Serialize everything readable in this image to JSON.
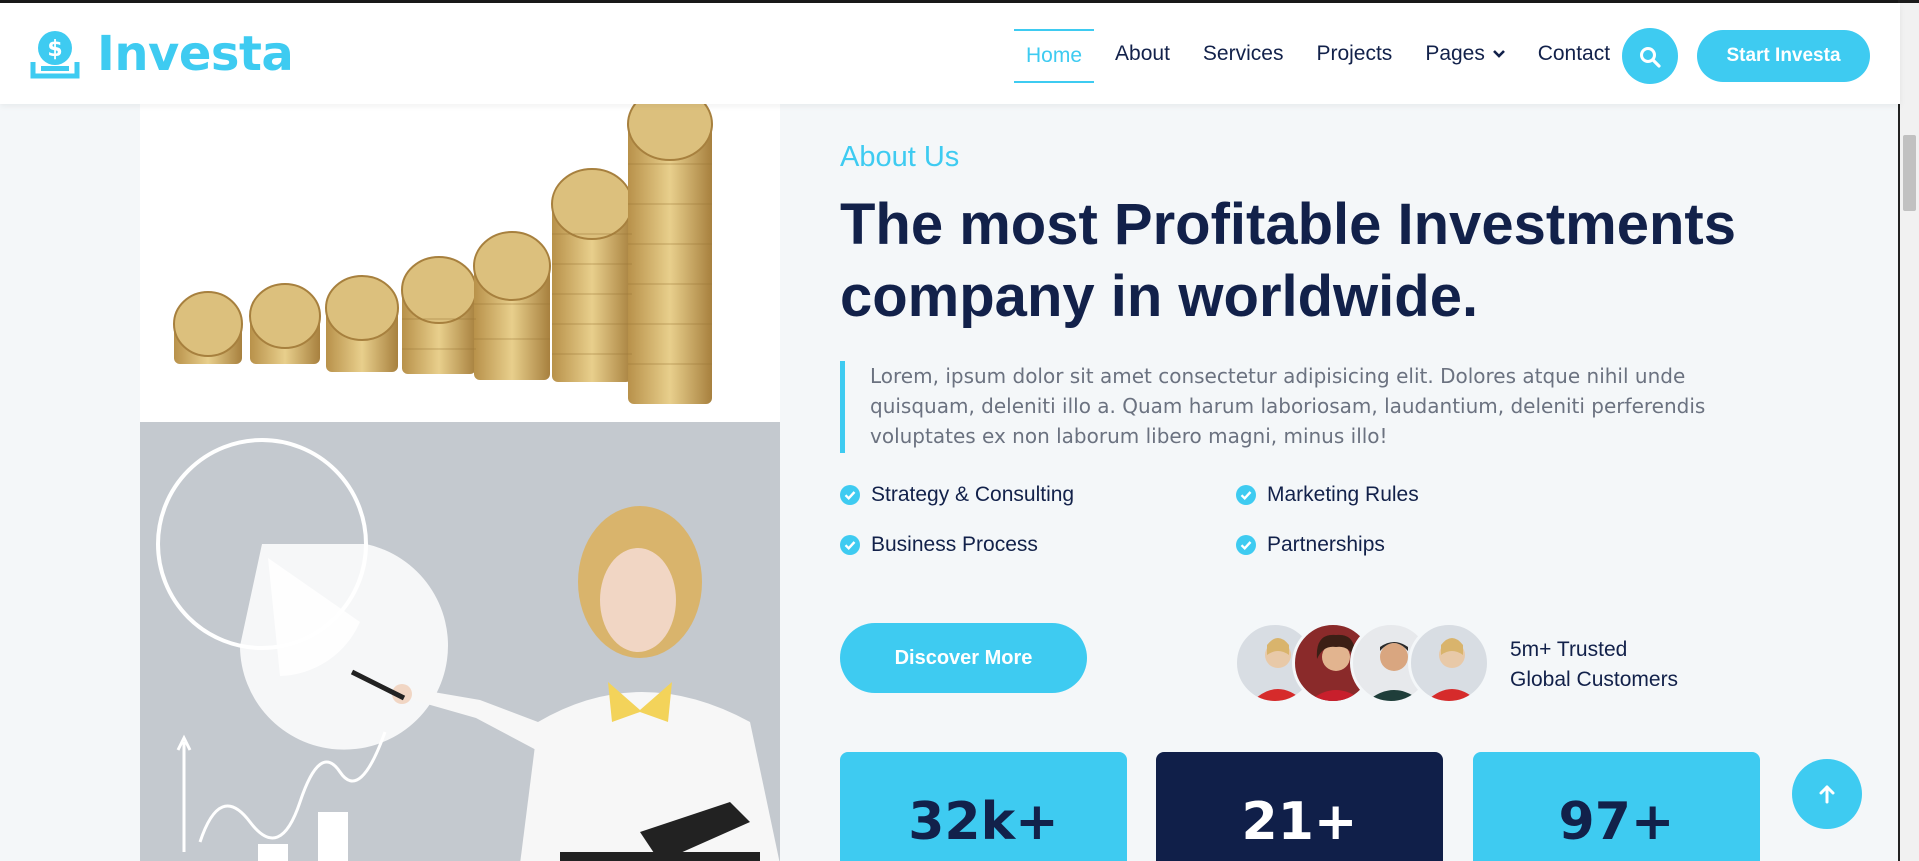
{
  "brand": {
    "name": "Investa",
    "icon": "dollar-coin-icon"
  },
  "nav": {
    "items": [
      {
        "label": "Home",
        "active": true
      },
      {
        "label": "About"
      },
      {
        "label": "Services"
      },
      {
        "label": "Projects"
      },
      {
        "label": "Pages",
        "has_dropdown": true
      },
      {
        "label": "Contact"
      }
    ],
    "search_icon": "search-icon",
    "cta_label": "Start Investa"
  },
  "about": {
    "eyebrow": "About Us",
    "headline_line1": "The most Profitable Investments",
    "headline_line2": "company in worldwide.",
    "quote": "Lorem, ipsum dolor sit amet consectetur adipisicing elit. Dolores atque nihil unde quisquam, deleniti illo a. Quam harum laboriosam, laudantium, deleniti perferendis voluptates ex non laborum libero magni, minus illo!",
    "features": [
      "Strategy & Consulting",
      "Marketing Rules",
      "Business Process",
      "Partnerships"
    ],
    "discover_label": "Discover More",
    "trusted_line1": "5m+ Trusted",
    "trusted_line2": "Global Customers"
  },
  "stats": [
    {
      "value": "32k+"
    },
    {
      "value": "21+"
    },
    {
      "value": "97+"
    }
  ],
  "colors": {
    "accent": "#3ecbf1",
    "navy": "#12214a",
    "dark_card": "#101f49",
    "background": "#f4f7f9"
  }
}
